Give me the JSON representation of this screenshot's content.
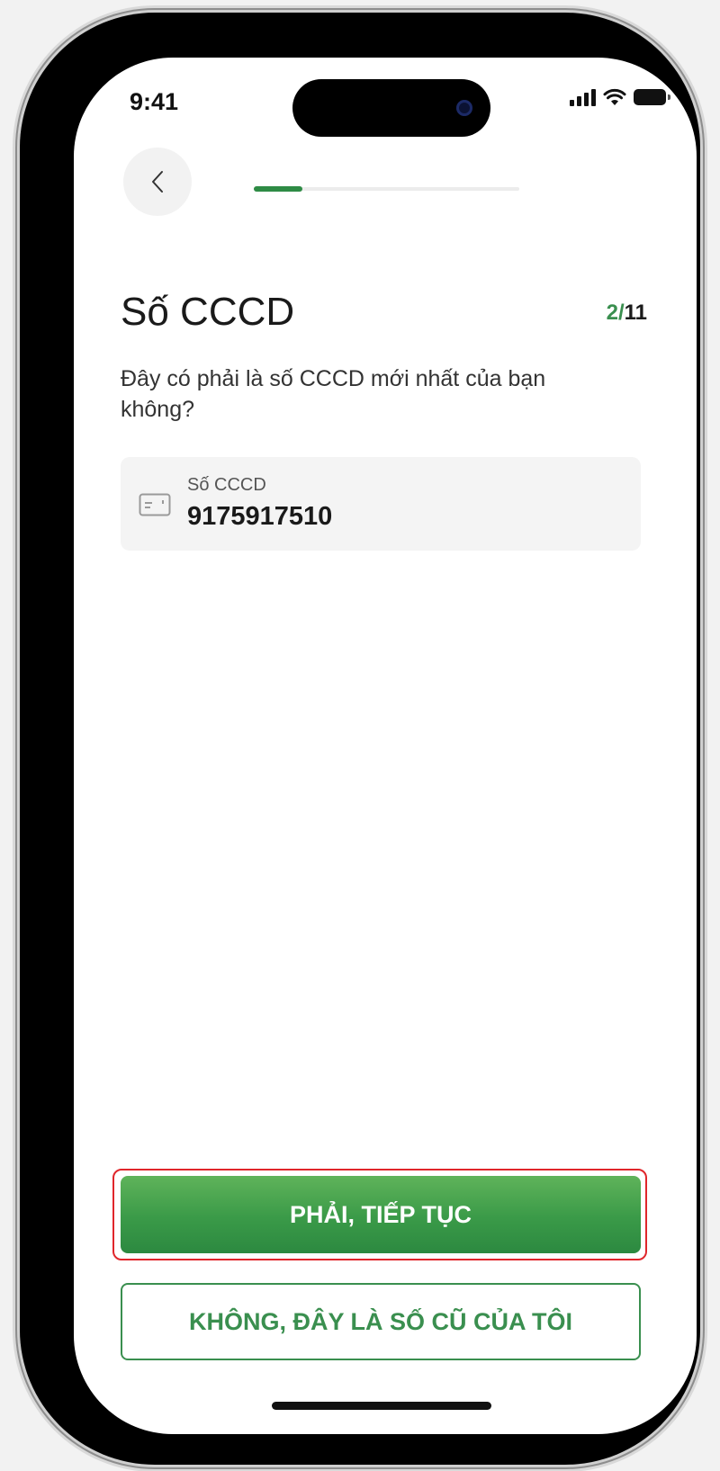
{
  "status_bar": {
    "time": "9:41",
    "icons": [
      "signal-icon",
      "wifi-icon",
      "battery-icon"
    ]
  },
  "nav": {
    "back_icon": "chevron-left-icon",
    "progress": {
      "current": 2,
      "total": 11
    }
  },
  "page": {
    "title": "Số CCCD",
    "step_current": "2",
    "step_separator": "/",
    "step_total": "11",
    "question": "Đây có phải là số CCCD mới nhất của bạn không?"
  },
  "id_card": {
    "icon": "id-card-icon",
    "label": "Số CCCD",
    "value": "9175917510"
  },
  "actions": {
    "primary_label": "PHẢI, TIẾP TỤC",
    "secondary_label": "KHÔNG, ĐÂY LÀ SỐ CŨ CỦA TÔI"
  },
  "colors": {
    "accent": "#3a8f4f",
    "highlight": "#e0262b"
  }
}
